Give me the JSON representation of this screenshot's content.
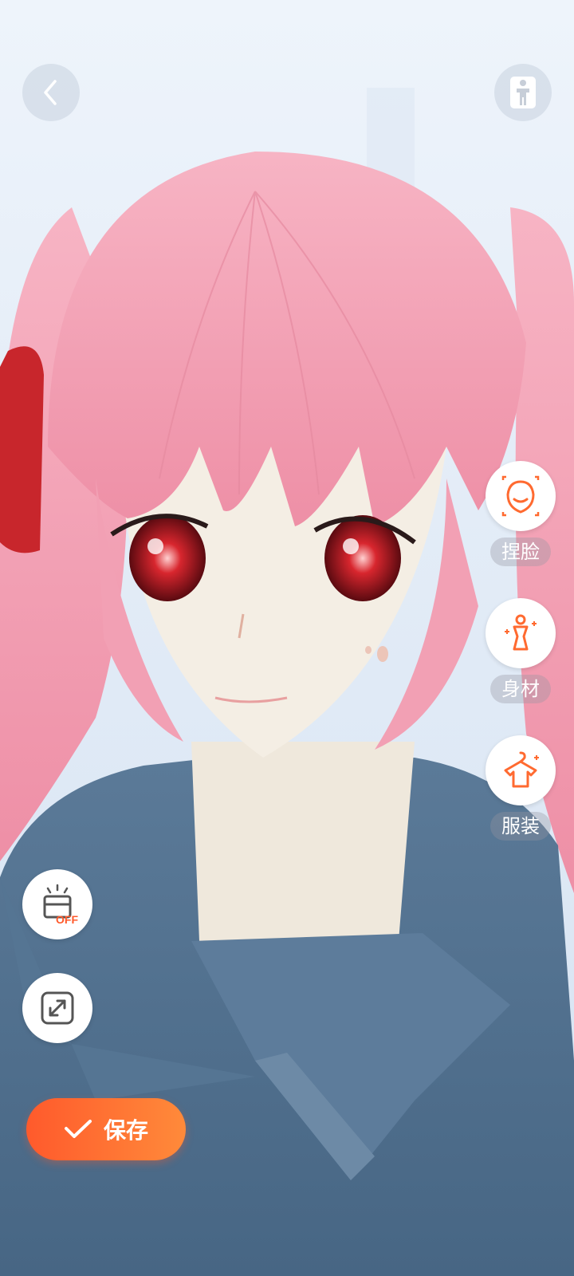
{
  "toolbar": {
    "back_icon": "chevron-left-icon",
    "body_view_icon": "person-standing-icon"
  },
  "side_tools": [
    {
      "label": "捏脸",
      "icon": "face-sculpt-icon"
    },
    {
      "label": "身材",
      "icon": "body-shape-icon"
    },
    {
      "label": "服装",
      "icon": "clothes-hanger-icon"
    }
  ],
  "left_tools": {
    "light_badge": "OFF",
    "light_icon": "spotlight-off-icon",
    "fullscreen_icon": "expand-icon"
  },
  "save": {
    "label": "保存",
    "icon": "checkmark-icon"
  },
  "colors": {
    "accent": "#ff6a30",
    "hair": "#f2a0b4",
    "shirt": "#4f6f90",
    "skin": "#f4eee4"
  }
}
